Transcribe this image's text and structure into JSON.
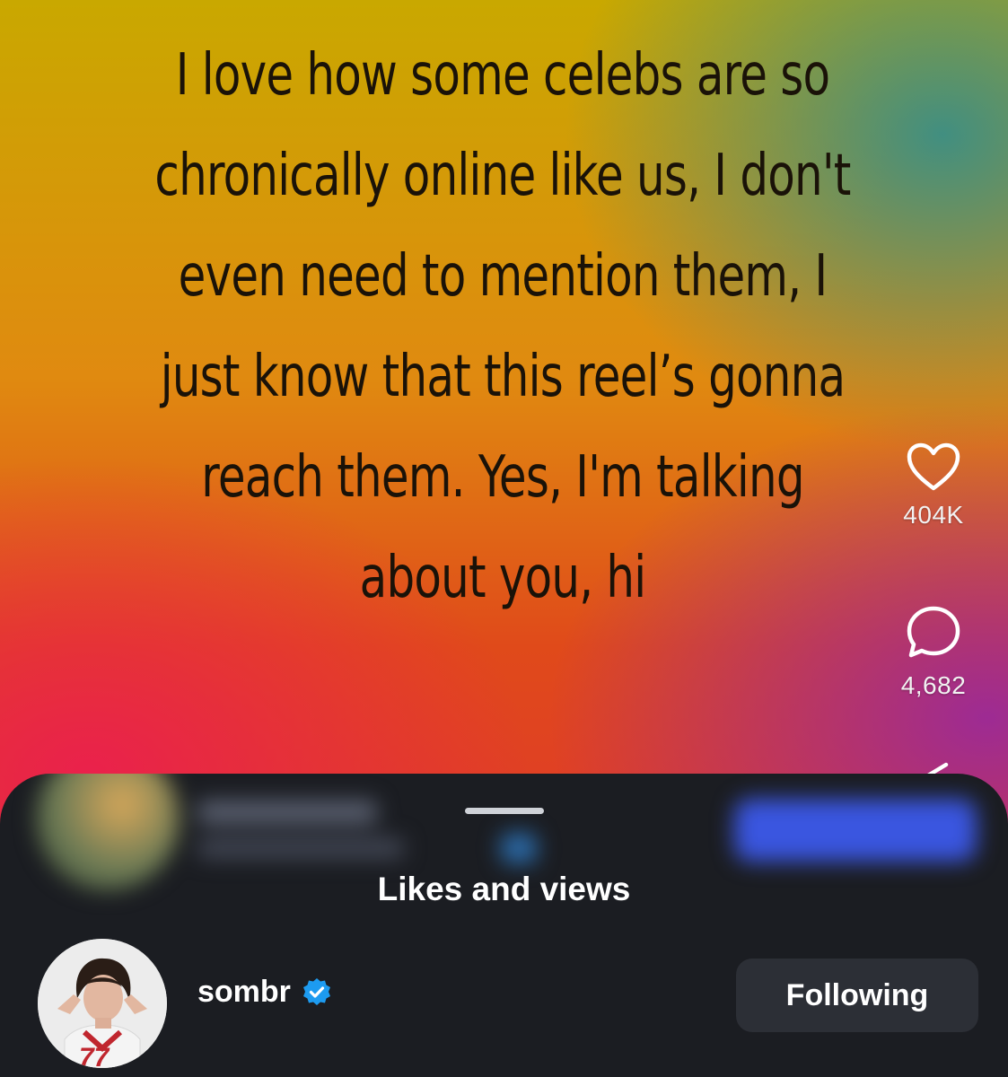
{
  "reel": {
    "caption_lines": [
      "I love how some celebs are so",
      "chronically online like us, I don't",
      "even need to mention them, I",
      "just know that this reel’s gonna",
      "reach them. Yes, I'm talking",
      "about you, hi"
    ],
    "likes_count": "404K",
    "comments_count": "4,682"
  },
  "sheet": {
    "title": "Likes and views",
    "user": {
      "username": "sombr",
      "verified": true,
      "follow_label": "Following"
    }
  },
  "colors": {
    "sheet_background": "#1b1d22",
    "button_background": "#2c2f36",
    "verified_badge": "#1d9bf0"
  },
  "icons": [
    "heart-icon",
    "comment-icon",
    "share-icon",
    "verified-badge-icon"
  ]
}
